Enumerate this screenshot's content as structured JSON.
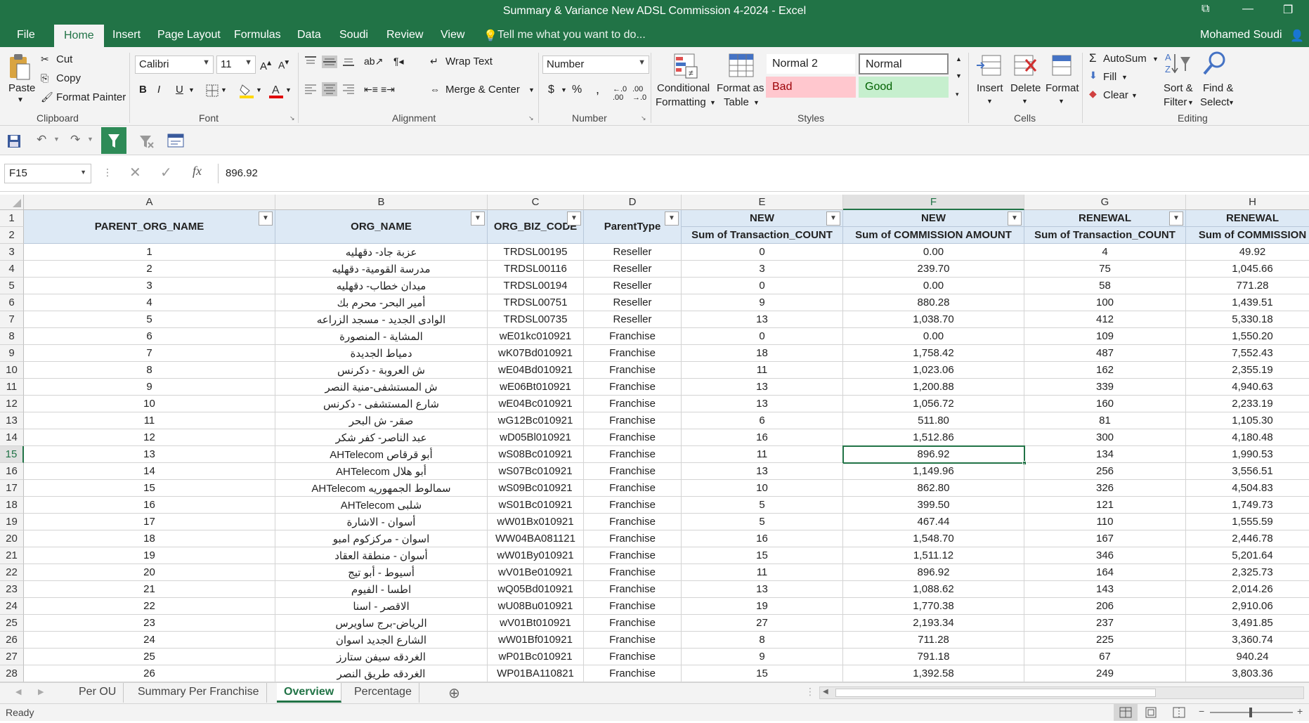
{
  "window": {
    "title": "Summary & Variance New ADSL Commission 4-2024 - Excel"
  },
  "tabs": [
    "File",
    "Home",
    "Insert",
    "Page Layout",
    "Formulas",
    "Data",
    "Soudi",
    "Review",
    "View"
  ],
  "tell_me": "Tell me what you want to do...",
  "user_name": "Mohamed Soudi",
  "ribbon": {
    "clipboard": {
      "paste": "Paste",
      "cut": "Cut",
      "copy": "Copy",
      "format_painter": "Format Painter",
      "label": "Clipboard"
    },
    "font": {
      "name": "Calibri",
      "size": "11",
      "bold": "B",
      "italic": "I",
      "underline": "U",
      "label": "Font"
    },
    "alignment": {
      "wrap_text": "Wrap Text",
      "merge_center": "Merge & Center",
      "label": "Alignment"
    },
    "number": {
      "format": "Number",
      "currency": "$",
      "percent": "%",
      "comma": ",",
      "label": "Number"
    },
    "styles": {
      "conditional": "Conditional",
      "formatting": "Formatting",
      "format_as": "Format as",
      "table": "Table",
      "normal2": "Normal 2",
      "normal": "Normal",
      "bad": "Bad",
      "good": "Good",
      "label": "Styles"
    },
    "cells": {
      "insert": "Insert",
      "delete": "Delete",
      "format": "Format",
      "label": "Cells"
    },
    "editing": {
      "autosum": "AutoSum",
      "fill": "Fill",
      "clear": "Clear",
      "sort": "Sort &",
      "filter": "Filter",
      "find": "Find &",
      "select": "Select",
      "label": "Editing"
    }
  },
  "formula_bar": {
    "name_box": "F15",
    "fx": "fx",
    "value": "896.92"
  },
  "columns": [
    "A",
    "B",
    "C",
    "D",
    "E",
    "F",
    "G",
    "H"
  ],
  "header": {
    "parent_org": "PARENT_ORG_NAME",
    "org_name": "ORG_NAME",
    "biz_code": "ORG_BIZ_CODE",
    "parent_type": "ParentType",
    "e_top": "NEW",
    "e_sub": "Sum of Transaction_COUNT",
    "f_top": "NEW",
    "f_sub": "Sum of COMMISSION AMOUNT",
    "g_top": "RENEWAL",
    "g_sub": "Sum of Transaction_COUNT",
    "h_top": "RENEWAL",
    "h_sub": "Sum of COMMISSION"
  },
  "rows": [
    {
      "r": "3",
      "a": "1",
      "b": "عزبة جاد- دقهليه",
      "c": "TRDSL00195",
      "d": "Reseller",
      "e": "0",
      "f": "0.00",
      "g": "4",
      "h": "49.92"
    },
    {
      "r": "4",
      "a": "2",
      "b": "مدرسة القومية- دقهليه",
      "c": "TRDSL00116",
      "d": "Reseller",
      "e": "3",
      "f": "239.70",
      "g": "75",
      "h": "1,045.66"
    },
    {
      "r": "5",
      "a": "3",
      "b": "ميدان خطاب- دقهليه",
      "c": "TRDSL00194",
      "d": "Reseller",
      "e": "0",
      "f": "0.00",
      "g": "58",
      "h": "771.28"
    },
    {
      "r": "6",
      "a": "4",
      "b": "أمير البحر- محرم بك",
      "c": "TRDSL00751",
      "d": "Reseller",
      "e": "9",
      "f": "880.28",
      "g": "100",
      "h": "1,439.51"
    },
    {
      "r": "7",
      "a": "5",
      "b": "الوادى الجديد - مسجد الزراعه",
      "c": "TRDSL00735",
      "d": "Reseller",
      "e": "13",
      "f": "1,038.70",
      "g": "412",
      "h": "5,330.18"
    },
    {
      "r": "8",
      "a": "6",
      "b": "المشاية - المنصورة",
      "c": "wE01kc010921",
      "d": "Franchise",
      "e": "0",
      "f": "0.00",
      "g": "109",
      "h": "1,550.20"
    },
    {
      "r": "9",
      "a": "7",
      "b": "دمياط الجديدة",
      "c": "wK07Bd010921",
      "d": "Franchise",
      "e": "18",
      "f": "1,758.42",
      "g": "487",
      "h": "7,552.43"
    },
    {
      "r": "10",
      "a": "8",
      "b": "ش العروبة - دكرنس",
      "c": "wE04Bd010921",
      "d": "Franchise",
      "e": "11",
      "f": "1,023.06",
      "g": "162",
      "h": "2,355.19"
    },
    {
      "r": "11",
      "a": "9",
      "b": "ش المستشفى-منية النصر",
      "c": "wE06Bt010921",
      "d": "Franchise",
      "e": "13",
      "f": "1,200.88",
      "g": "339",
      "h": "4,940.63"
    },
    {
      "r": "12",
      "a": "10",
      "b": "شارع المستشفى - دكرنس",
      "c": "wE04Bc010921",
      "d": "Franchise",
      "e": "13",
      "f": "1,056.72",
      "g": "160",
      "h": "2,233.19"
    },
    {
      "r": "13",
      "a": "11",
      "b": "صقر- ش البحر",
      "c": "wG12Bc010921",
      "d": "Franchise",
      "e": "6",
      "f": "511.80",
      "g": "81",
      "h": "1,105.30"
    },
    {
      "r": "14",
      "a": "12",
      "b": "عبد الناصر- كفر شكر",
      "c": "wD05Bl010921",
      "d": "Franchise",
      "e": "16",
      "f": "1,512.86",
      "g": "300",
      "h": "4,180.48"
    },
    {
      "r": "15",
      "a": "13",
      "b": "AHTelecom أبو قرقاص",
      "c": "wS08Bc010921",
      "d": "Franchise",
      "e": "11",
      "f": "896.92",
      "g": "134",
      "h": "1,990.53"
    },
    {
      "r": "16",
      "a": "14",
      "b": "AHTelecom أبو هلال",
      "c": "wS07Bc010921",
      "d": "Franchise",
      "e": "13",
      "f": "1,149.96",
      "g": "256",
      "h": "3,556.51"
    },
    {
      "r": "17",
      "a": "15",
      "b": "AHTelecom سمالوط الجمهوريه",
      "c": "wS09Bc010921",
      "d": "Franchise",
      "e": "10",
      "f": "862.80",
      "g": "326",
      "h": "4,504.83"
    },
    {
      "r": "18",
      "a": "16",
      "b": "AHTelecom شلبى",
      "c": "wS01Bc010921",
      "d": "Franchise",
      "e": "5",
      "f": "399.50",
      "g": "121",
      "h": "1,749.73"
    },
    {
      "r": "19",
      "a": "17",
      "b": "أسوان - الاشارة",
      "c": "wW01Bx010921",
      "d": "Franchise",
      "e": "5",
      "f": "467.44",
      "g": "110",
      "h": "1,555.59"
    },
    {
      "r": "20",
      "a": "18",
      "b": "اسوان - مركزكوم امبو",
      "c": "WW04BA081121",
      "d": "Franchise",
      "e": "16",
      "f": "1,548.70",
      "g": "167",
      "h": "2,446.78"
    },
    {
      "r": "21",
      "a": "19",
      "b": "أسوان - منطقة العقاد",
      "c": "wW01By010921",
      "d": "Franchise",
      "e": "15",
      "f": "1,511.12",
      "g": "346",
      "h": "5,201.64"
    },
    {
      "r": "22",
      "a": "20",
      "b": "أسيوط - أبو تيج",
      "c": "wV01Be010921",
      "d": "Franchise",
      "e": "11",
      "f": "896.92",
      "g": "164",
      "h": "2,325.73"
    },
    {
      "r": "23",
      "a": "21",
      "b": "اطسا - الفيوم",
      "c": "wQ05Bd010921",
      "d": "Franchise",
      "e": "13",
      "f": "1,088.62",
      "g": "143",
      "h": "2,014.26"
    },
    {
      "r": "24",
      "a": "22",
      "b": "الاقصر - اسنا",
      "c": "wU08Bu010921",
      "d": "Franchise",
      "e": "19",
      "f": "1,770.38",
      "g": "206",
      "h": "2,910.06"
    },
    {
      "r": "25",
      "a": "23",
      "b": "الرياض-برج ساويرس",
      "c": "wV01Bt010921",
      "d": "Franchise",
      "e": "27",
      "f": "2,193.34",
      "g": "237",
      "h": "3,491.85"
    },
    {
      "r": "26",
      "a": "24",
      "b": "الشارع الجديد اسوان",
      "c": "wW01Bf010921",
      "d": "Franchise",
      "e": "8",
      "f": "711.28",
      "g": "225",
      "h": "3,360.74"
    },
    {
      "r": "27",
      "a": "25",
      "b": "الغردقه سيفن ستارز",
      "c": "wP01Bc010921",
      "d": "Franchise",
      "e": "9",
      "f": "791.18",
      "g": "67",
      "h": "940.24"
    },
    {
      "r": "28",
      "a": "26",
      "b": "الغردقه طريق النصر",
      "c": "WP01BA110821",
      "d": "Franchise",
      "e": "15",
      "f": "1,392.58",
      "g": "249",
      "h": "3,803.36"
    }
  ],
  "sheets": [
    "Per OU",
    "Summary Per Franchise",
    "Overview",
    "Percentage"
  ],
  "active_sheet": "Overview",
  "status": {
    "ready": "Ready"
  },
  "colors": {
    "excel_green": "#217346",
    "header_fill": "#dde9f5",
    "bad_fill": "#ffc7ce",
    "good_fill": "#c6efce"
  }
}
